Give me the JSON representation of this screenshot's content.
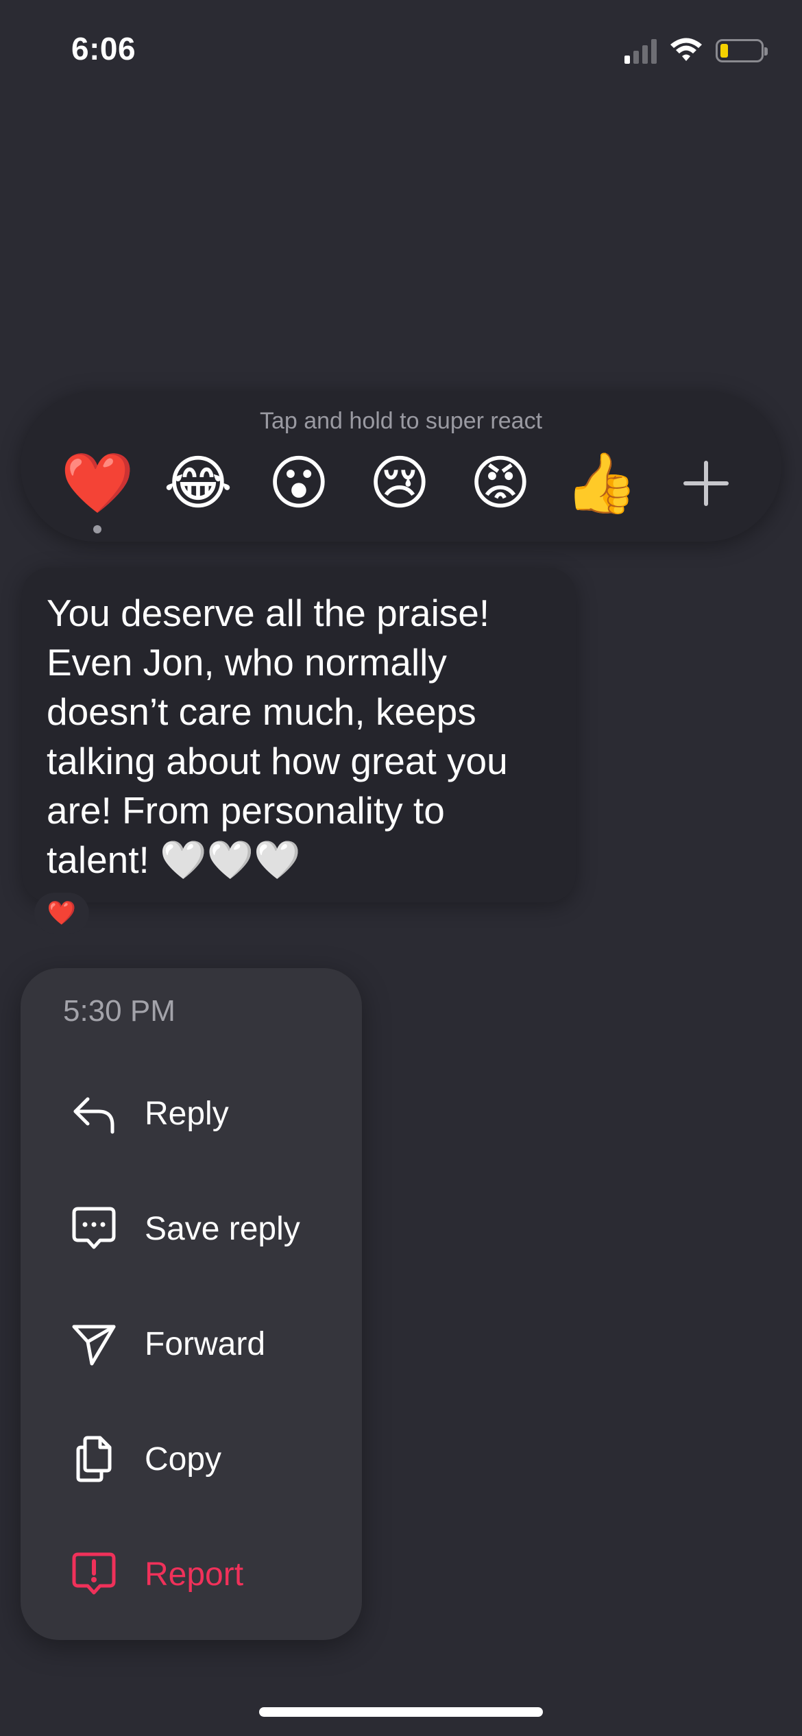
{
  "status_bar": {
    "time": "6:06",
    "battery_color": "#f5d200"
  },
  "reaction_bar": {
    "hint": "Tap and hold to super react",
    "reactions": [
      {
        "emoji": "❤️",
        "name": "red-heart"
      },
      {
        "emoji": "😂",
        "name": "tears-of-joy"
      },
      {
        "emoji": "😮",
        "name": "surprised"
      },
      {
        "emoji": "😢",
        "name": "crying"
      },
      {
        "emoji": "😡",
        "name": "angry"
      },
      {
        "emoji": "👍",
        "name": "thumbs-up"
      }
    ],
    "more_icon": "plus-icon"
  },
  "message": {
    "text": "You deserve all the praise! Even Jon, who normally doesn’t care much, keeps talking about how great you are! From personality to talent! 🤍🤍🤍",
    "reaction": "❤️"
  },
  "menu": {
    "timestamp": "5:30 PM",
    "items": [
      {
        "label": "Reply",
        "icon": "reply-icon"
      },
      {
        "label": "Save reply",
        "icon": "chat-bubble-icon"
      },
      {
        "label": "Forward",
        "icon": "send-icon"
      },
      {
        "label": "Copy",
        "icon": "copy-icon"
      },
      {
        "label": "Report",
        "icon": "report-icon",
        "color": "#f0315a"
      }
    ]
  }
}
